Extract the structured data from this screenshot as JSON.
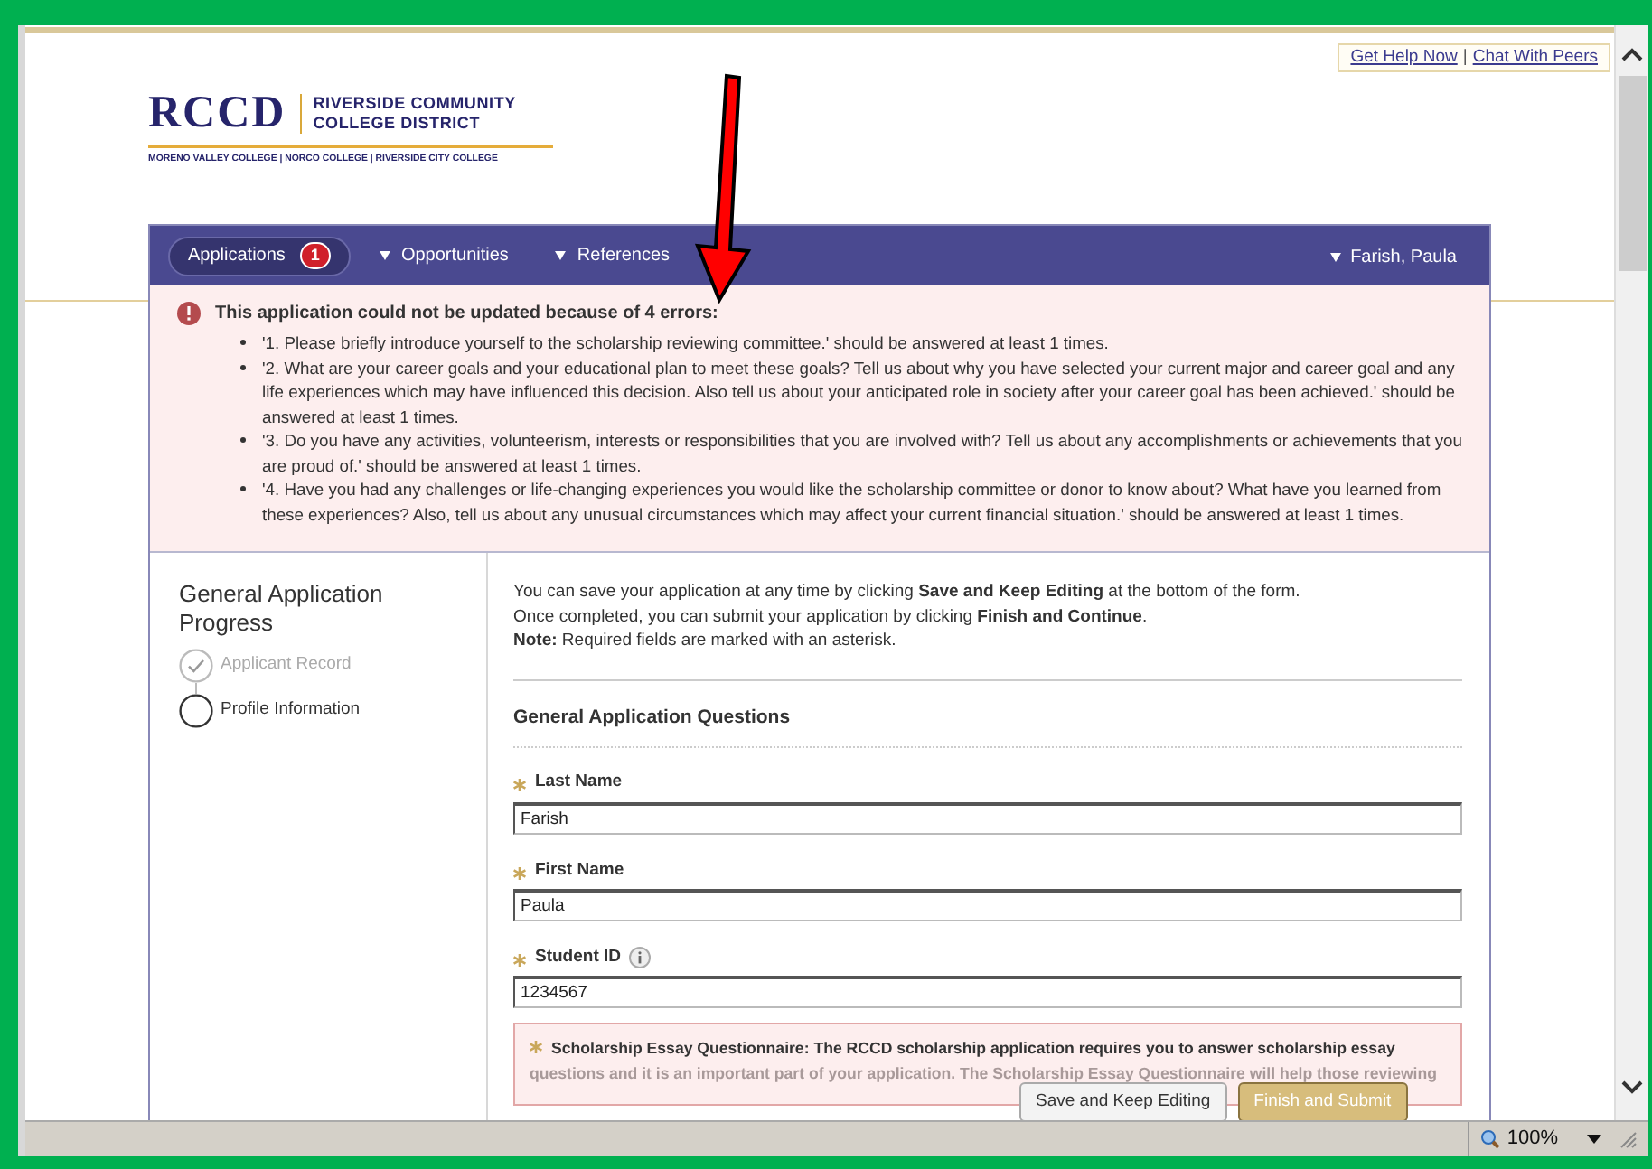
{
  "help_links": [
    {
      "label": "Get Help Now"
    },
    {
      "label": "Chat With Peers"
    }
  ],
  "help_separator": "|",
  "logo": {
    "acronym": "RCCD",
    "name_lines": [
      "RIVERSIDE COMMUNITY",
      "COLLEGE DISTRICT"
    ],
    "colleges": "MORENO VALLEY COLLEGE | NORCO COLLEGE | RIVERSIDE CITY COLLEGE"
  },
  "nav": {
    "tabs": [
      {
        "label": "Applications",
        "badge": "1",
        "selected": true,
        "dropdown": false
      },
      {
        "label": "Opportunities",
        "selected": false,
        "dropdown": true
      },
      {
        "label": "References",
        "selected": false,
        "dropdown": true
      }
    ],
    "user": {
      "label": "Farish, Paula",
      "dropdown": true
    }
  },
  "error": {
    "title": "This application could not be updated because of 4 errors:",
    "items": [
      "'1. Please briefly introduce yourself to the scholarship reviewing committee.' should be answered at least 1 times.",
      "'2. What are your career goals and your educational plan to meet these goals? Tell us about why you have selected your current major and career goal and any life experiences which may have influenced this decision. Also tell us about your anticipated role in society after your career goal has been achieved.' should be answered at least 1 times.",
      "'3. Do you have any activities, volunteerism, interests or responsibilities that you are involved with? Tell us about any accomplishments or achievements that you are proud of.' should be answered at least 1 times.",
      "'4. Have you had any challenges or life-changing experiences you would like the scholarship committee or donor to know about? What have you learned from these experiences? Also, tell us about any unusual circumstances which may affect your current financial situation.' should be answered at least 1 times."
    ]
  },
  "progress": {
    "title": "General Application Progress",
    "steps": [
      {
        "label": "Applicant Record",
        "completed": true
      },
      {
        "label": "Profile Information",
        "completed": false
      }
    ]
  },
  "intro": [
    "You can save your application at any time by clicking **Save and Keep Editing** at the bottom of the form.",
    "Once completed, you can submit your application by clicking **Finish and Continue**.",
    "**Note:** Required fields are marked with an asterisk."
  ],
  "section_title": "General Application Questions",
  "fields": [
    {
      "label": "Last Name",
      "required": true,
      "info": false,
      "value": "Farish"
    },
    {
      "label": "First Name",
      "required": true,
      "info": false,
      "value": "Paula"
    },
    {
      "label": "Student ID",
      "required": true,
      "info": true,
      "value": "1234567"
    }
  ],
  "essay_notice": {
    "required": true,
    "title": "Scholarship Essay Questionnaire: The RCCD scholarship application requires you to answer scholarship essay",
    "faded_lines": [
      "questions and it is an important part of your application. The Scholarship Essay Questionnaire will help those reviewing"
    ]
  },
  "buttons": [
    {
      "label": "Save and Keep Editing",
      "kind": "secondary"
    },
    {
      "label": "Finish and Submit",
      "kind": "primary"
    }
  ],
  "status_bar": {
    "zoom": "100%"
  }
}
